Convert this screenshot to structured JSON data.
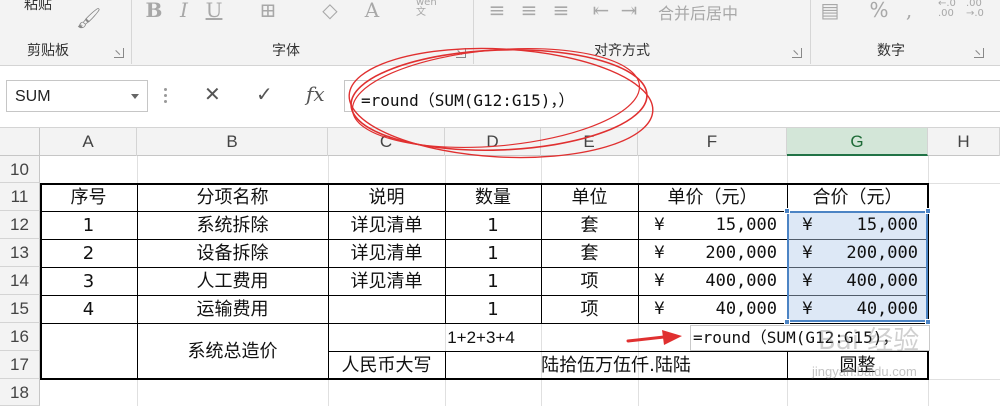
{
  "ribbon": {
    "paste_label": "粘贴",
    "groups": {
      "clipboard": "剪贴板",
      "font": "字体",
      "alignment": "对齐方式",
      "number": "数字"
    },
    "merge_center_label": "合并后居中",
    "percent_symbol": "%",
    "decimal_increase": "←.0 .00",
    "decimal_decrease": ".00 →.0",
    "wen_label": "wén 文"
  },
  "formula_bar": {
    "name_box": "SUM",
    "cancel_symbol": "✕",
    "enter_symbol": "✓",
    "fx_symbol": "fx",
    "formula": "=round（SUM(G12:G15)，）"
  },
  "columns": [
    "A",
    "B",
    "C",
    "D",
    "E",
    "F",
    "G",
    "H"
  ],
  "rows": [
    "10",
    "11",
    "12",
    "13",
    "14",
    "15",
    "16",
    "17",
    "18"
  ],
  "table": {
    "headers": [
      "序号",
      "分项名称",
      "说明",
      "数量",
      "单位",
      "单价（元）",
      "合价（元）"
    ],
    "items": [
      {
        "no": "1",
        "name": "系统拆除",
        "note": "详见清单",
        "qty": "1",
        "unit": "套",
        "price": "15,000",
        "total": "15,000"
      },
      {
        "no": "2",
        "name": "设备拆除",
        "note": "详见清单",
        "qty": "1",
        "unit": "套",
        "price": "200,000",
        "total": "200,000"
      },
      {
        "no": "3",
        "name": "人工费用",
        "note": "详见清单",
        "qty": "1",
        "unit": "项",
        "price": "400,000",
        "total": "400,000"
      },
      {
        "no": "4",
        "name": "运输费用",
        "note": "",
        "qty": "1",
        "unit": "项",
        "price": "40,000",
        "total": "40,000"
      }
    ],
    "currency_symbol": "¥",
    "total_label": "系统总造价",
    "sum_expression": "1+2+3+4",
    "formula_echo": "=round（SUM(G12:G15)，",
    "rmb_uppercase_label": "人民币大写",
    "amount_in_words": "陆拾伍万伍仟.陆陆",
    "yuan_whole": "圆整"
  },
  "watermark": {
    "main": "Bai 经验",
    "url": "jingyan.baidu.com"
  },
  "colors": {
    "selection_border": "#4c84c4",
    "annotation_red": "#e03030",
    "selected_header": "#217346"
  }
}
